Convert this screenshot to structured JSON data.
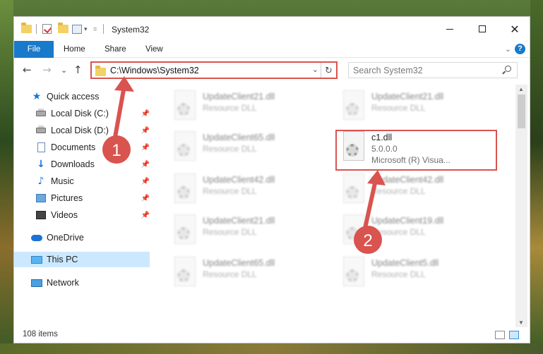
{
  "window": {
    "title": "System32",
    "controls": {
      "minimize": "",
      "maximize": "",
      "close": "✕"
    }
  },
  "ribbon": {
    "tabs": [
      {
        "label": "File",
        "active": true
      },
      {
        "label": "Home"
      },
      {
        "label": "Share"
      },
      {
        "label": "View"
      }
    ],
    "help": "?",
    "collapse": "⌄"
  },
  "nav": {
    "back": "←",
    "forward": "→",
    "recent": "⌄",
    "up": "↑",
    "address": "C:\\Windows\\System32",
    "address_dropdown": "⌄",
    "refresh": "↻",
    "search_placeholder": "Search System32"
  },
  "sidebar": {
    "items": [
      {
        "label": "Quick access",
        "icon": "star-icon"
      },
      {
        "label": "Local Disk (C:)",
        "icon": "disk-icon",
        "pinned": true
      },
      {
        "label": "Local Disk (D:)",
        "icon": "disk-icon",
        "pinned": true
      },
      {
        "label": "Documents",
        "icon": "documents-icon",
        "pinned": true
      },
      {
        "label": "Downloads",
        "icon": "download-icon",
        "pinned": true
      },
      {
        "label": "Music",
        "icon": "music-icon",
        "pinned": true
      },
      {
        "label": "Pictures",
        "icon": "pictures-icon",
        "pinned": true
      },
      {
        "label": "Videos",
        "icon": "videos-icon",
        "pinned": true
      },
      {
        "label": "OneDrive",
        "icon": "cloud-icon"
      },
      {
        "label": "This PC",
        "icon": "computer-icon",
        "selected": true
      },
      {
        "label": "Network",
        "icon": "network-icon"
      }
    ],
    "pin_glyph": "📌"
  },
  "files": {
    "items": [
      {
        "name": "UpdateClient21.dll",
        "type": "Resource DLL"
      },
      {
        "name": "UpdateClient21.dll",
        "type": "Resource DLL"
      },
      {
        "name": "UpdateClient65.dll",
        "type": "Resource DLL"
      },
      {
        "name": "c1.dll",
        "version": "5.0.0.0",
        "company": "Microsoft (R) Visua..."
      },
      {
        "name": "UpdateClient42.dll",
        "type": "Resource DLL"
      },
      {
        "name": "UpdateClient42.dll",
        "type": "Resource DLL"
      },
      {
        "name": "UpdateClient21.dll",
        "type": "Resource DLL"
      },
      {
        "name": "UpdateClient19.dll",
        "type": "Resource DLL"
      },
      {
        "name": "UpdateClient65.dll",
        "type": "Resource DLL"
      },
      {
        "name": "UpdateClient5.dll",
        "type": "Resource DLL"
      }
    ]
  },
  "status": {
    "item_count": "108 items"
  },
  "annotations": {
    "step1": "1",
    "step2": "2",
    "color": "#d9534f"
  }
}
